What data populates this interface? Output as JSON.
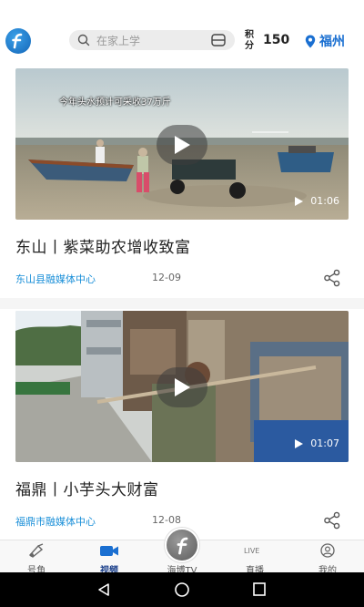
{
  "header": {
    "search_placeholder": "在家上学",
    "points_label": "积分",
    "points_value": "150",
    "city": "福州"
  },
  "videos": [
    {
      "overlay_caption": "今年头水预计可采收37万斤",
      "duration": "01:06",
      "title": "东山丨紫菜助农增收致富",
      "source": "东山县融媒体中心",
      "date": "12-09"
    },
    {
      "duration": "01:07",
      "title": "福鼎丨小芋头大财富",
      "source": "福鼎市融媒体中心",
      "date": "12-08"
    }
  ],
  "bottom_nav": {
    "items": [
      {
        "label": "号角",
        "icon": "horn-icon"
      },
      {
        "label": "视频",
        "icon": "video-camera-icon",
        "active": true
      },
      {
        "label": "海博TV",
        "icon": "haibo-logo-icon"
      },
      {
        "label": "直播",
        "icon": "live-icon"
      },
      {
        "label": "我的",
        "icon": "user-icon"
      }
    ]
  },
  "colors": {
    "accent": "#1a6fd1",
    "source_text": "#1a8fd8",
    "active_nav": "#1a3f8a"
  }
}
